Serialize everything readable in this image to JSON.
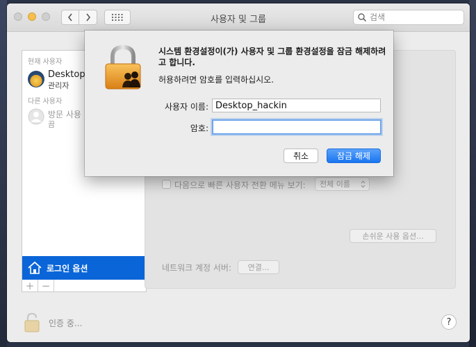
{
  "window": {
    "title": "사용자 및 그룹",
    "search_placeholder": "검색"
  },
  "sidebar": {
    "current_user_header": "현재 사용자",
    "current_user": {
      "name": "Desktop_",
      "role": "관리자"
    },
    "other_users_header": "다른 사용자",
    "guest_user": {
      "name_line1": "방문 사용",
      "name_line2": "끔"
    },
    "login_options_label": "로그인 옵션",
    "add_label": "+",
    "remove_label": "−"
  },
  "content": {
    "fast_switch_label": "다음으로 빠른 사용자 전환 메뉴 보기:",
    "fast_switch_value": "전체 이름",
    "accessibility_button": "손쉬운 사용 옵션...",
    "network_server_label": "네트워크 계정 서버:",
    "connect_button": "연결..."
  },
  "footer": {
    "auth_status": "인증 중...",
    "help_label": "?"
  },
  "dialog": {
    "message": "시스템 환경설정이(가) 사용자 및 그룹 환경설정을 잠금 해제하려고 합니다.",
    "instruction": "허용하려면 암호를 입력하십시오.",
    "username_label": "사용자 이름:",
    "username_value": "Desktop_hackin",
    "password_label": "암호:",
    "password_value": "",
    "cancel_button": "취소",
    "unlock_button": "잠금 해제"
  },
  "colors": {
    "accent": "#0a65d8",
    "primary_button": "#1976f0",
    "lock_gold": "#f0a030"
  }
}
